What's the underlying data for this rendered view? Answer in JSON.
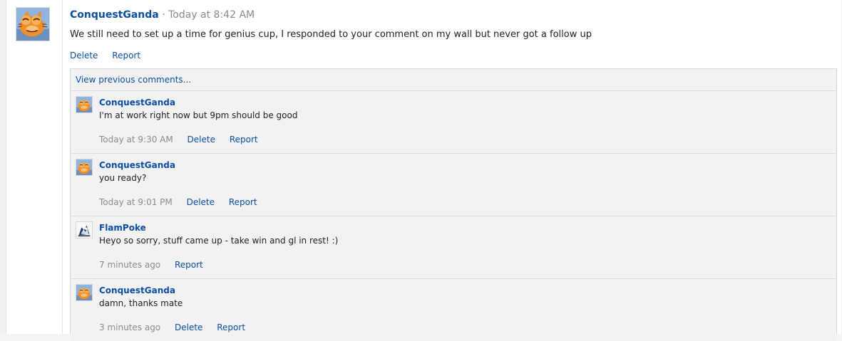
{
  "post": {
    "author": "ConquestGanda",
    "time": " · Today at 8:42 AM",
    "text": "We still need to set up a time for genius cup, I responded to your comment on my wall but never got a follow up",
    "actions": {
      "delete": "Delete",
      "report": "Report"
    }
  },
  "comments": {
    "view_previous": "View previous comments...",
    "items": [
      {
        "author": "ConquestGanda",
        "text": "I'm at work right now but 9pm should be good",
        "time": "Today at 9:30 AM",
        "delete": "Delete",
        "report": "Report"
      },
      {
        "author": "ConquestGanda",
        "text": "you ready?",
        "time": "Today at 9:01 PM",
        "delete": "Delete",
        "report": "Report"
      },
      {
        "author": "FlamPoke",
        "text": "Heyo so sorry, stuff came up - take win and gl in rest! :)",
        "time": "7 minutes ago",
        "report": "Report"
      },
      {
        "author": "ConquestGanda",
        "text": "damn, thanks mate",
        "time": "3 minutes ago",
        "delete": "Delete",
        "report": "Report"
      }
    ]
  },
  "colors": {
    "link": "#0b4fa3",
    "muted": "#8b8b8b",
    "text": "#222222",
    "panel": "#f2f2f2",
    "border": "#d7d7d7"
  },
  "icons": {
    "post_avatar": "garfield-avatar-icon",
    "comment_avatar_1": "garfield-avatar-icon",
    "comment_avatar_2": "garfield-avatar-icon",
    "comment_avatar_3": "flampoke-avatar-icon",
    "comment_avatar_4": "garfield-avatar-icon"
  }
}
